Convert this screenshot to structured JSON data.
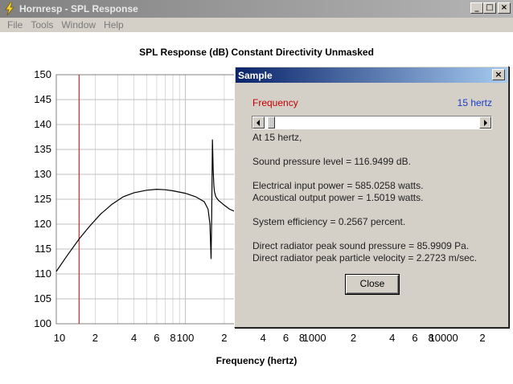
{
  "window": {
    "title": "Hornresp - SPL Response",
    "minimize_glyph": "_",
    "maximize_glyph": "□",
    "close_glyph": "×"
  },
  "menu": [
    "File",
    "Tools",
    "Window",
    "Help"
  ],
  "chart_data": {
    "type": "line",
    "title": "SPL Response (dB)   Constant Directivity   Unmasked",
    "xlabel": "Frequency (hertz)",
    "ylabel": "",
    "x_scale": "log",
    "xlim": [
      10,
      20000
    ],
    "ylim": [
      100,
      150
    ],
    "y_ticks": [
      "150",
      "145",
      "140",
      "135",
      "130",
      "125",
      "120",
      "115",
      "110",
      "105",
      "100"
    ],
    "x_ticks": [
      {
        "label": "10",
        "value": 10
      },
      {
        "label": "2",
        "value": 20
      },
      {
        "label": "4",
        "value": 40
      },
      {
        "label": "6",
        "value": 60
      },
      {
        "label": "8",
        "value": 80
      },
      {
        "label": "100",
        "value": 100
      },
      {
        "label": "2",
        "value": 200
      },
      {
        "label": "4",
        "value": 400
      },
      {
        "label": "6",
        "value": 600
      },
      {
        "label": "8",
        "value": 800
      },
      {
        "label": "1000",
        "value": 1000
      },
      {
        "label": "2",
        "value": 2000
      },
      {
        "label": "4",
        "value": 4000
      },
      {
        "label": "6",
        "value": 6000
      },
      {
        "label": "8",
        "value": 8000
      },
      {
        "label": "10000",
        "value": 10000
      },
      {
        "label": "2",
        "value": 20000
      }
    ],
    "grid": true,
    "marker_frequency": 15,
    "colors": {
      "curve": "#000000",
      "marker": "#cc0000",
      "grid": "#c0c0c0"
    },
    "series": [
      {
        "x": [
          10,
          12,
          15,
          18,
          22,
          27,
          33,
          40,
          50,
          60,
          70,
          80,
          100,
          120,
          140,
          150,
          155,
          158,
          160,
          162,
          164,
          166,
          168,
          172,
          180,
          200,
          220,
          240
        ],
        "y": [
          110.5,
          113.5,
          117.0,
          119.5,
          122.0,
          124.0,
          125.5,
          126.3,
          126.8,
          127.0,
          126.9,
          126.7,
          126.2,
          125.5,
          124.5,
          123.0,
          120.0,
          113.0,
          122.0,
          137.0,
          131.0,
          128.0,
          126.5,
          125.5,
          124.8,
          123.8,
          123.0,
          122.6
        ]
      }
    ]
  },
  "dialog": {
    "title": "Sample",
    "close_glyph": "×",
    "frequency_label": "Frequency",
    "frequency_value": "15 hertz",
    "slider_position": 0.01,
    "lines": [
      "At 15 hertz,",
      "Sound pressure level = 116.9499 dB.",
      "Electrical input power = 585.0258 watts.",
      "Acoustical output power = 1.5019 watts.",
      "System efficiency = 0.2567 percent.",
      "Direct radiator peak sound pressure = 85.9909 Pa.",
      "Direct radiator peak particle velocity = 2.2723 m/sec."
    ],
    "close_button_label": "Close"
  }
}
